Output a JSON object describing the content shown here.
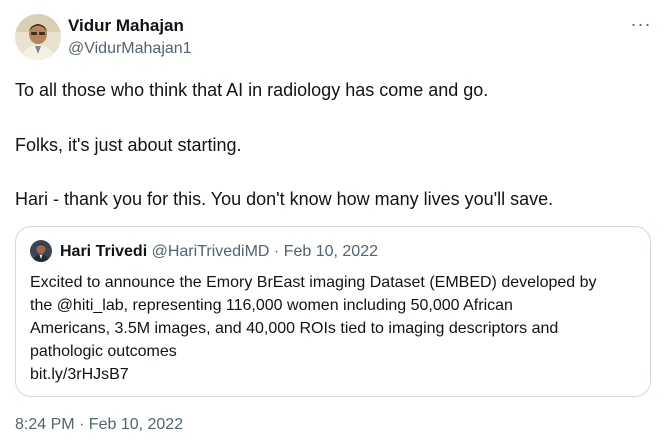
{
  "author": {
    "name": "Vidur Mahajan",
    "handle": "@VidurMahajan1"
  },
  "more_icon": "more-horizontal-icon",
  "tweet_lines": [
    "To all those who think that AI in radiology has come and go.",
    "Folks, it's just about starting.",
    "Hari - thank you for this. You don't know how many lives you'll save."
  ],
  "quoted": {
    "name": "Hari Trivedi",
    "meta": "@HariTrivediMD · Feb 10, 2022",
    "lines": [
      "Excited to announce the Emory BrEast imaging Dataset (EMBED) developed by",
      "the @hiti_lab, representing 116,000 women including 50,000 African",
      "Americans, 3.5M images, and 40,000 ROIs tied to imaging descriptors and",
      "pathologic outcomes",
      "bit.ly/3rHJsB7"
    ]
  },
  "timestamp": "8:24 PM · Feb 10, 2022",
  "colors": {
    "text": "#0f1419",
    "secondary": "#536471",
    "border": "#cfd9de"
  }
}
